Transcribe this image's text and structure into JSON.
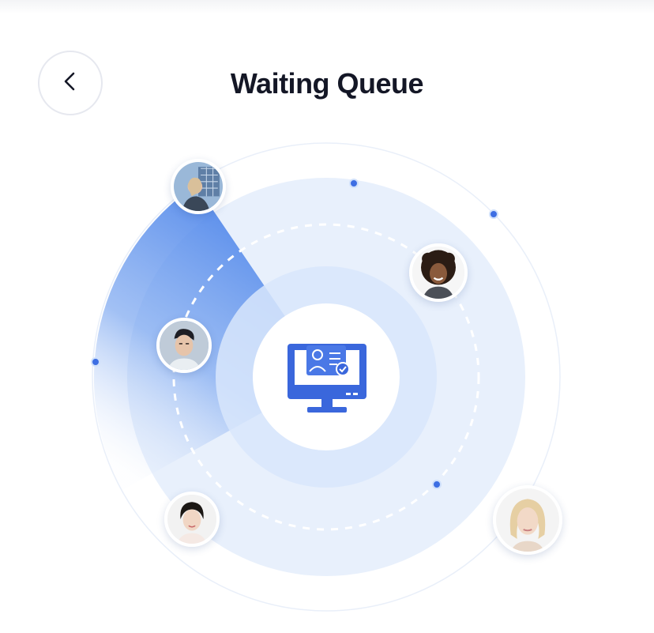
{
  "header": {
    "title": "Waiting Queue",
    "back_icon": "chevron-left-icon"
  },
  "radar": {
    "center_icon": "monitor-id-card-icon",
    "accent_color": "#3d6ee3",
    "users": [
      {
        "id": "user-top-left",
        "icon": "avatar-photo"
      },
      {
        "id": "user-right",
        "icon": "avatar-photo"
      },
      {
        "id": "user-left",
        "icon": "avatar-photo"
      },
      {
        "id": "user-bottom-left",
        "icon": "avatar-photo"
      },
      {
        "id": "user-bottom-right",
        "icon": "avatar-photo"
      }
    ]
  }
}
